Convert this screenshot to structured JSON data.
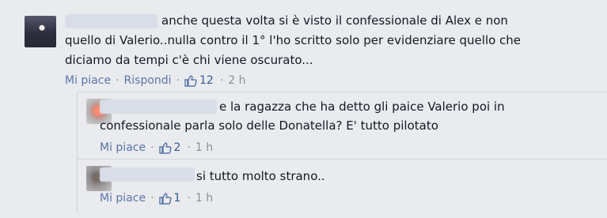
{
  "comments": [
    {
      "avatar_icon": "user-avatar-icon",
      "text_lines": [
        "anche questa volta si è visto il confessionale di Alex e non",
        "quello di Valerio..nulla contro il 1° l'ho scritto solo per evidenziare quello che",
        "diciamo da tempi c'è chi viene oscurato..."
      ],
      "actions": {
        "like_label": "Mi piace",
        "reply_label": "Rispondi",
        "likes": "12",
        "time": "2 h"
      }
    },
    {
      "avatar_icon": "user-avatar-icon",
      "text_lines": [
        "e la ragazza che ha detto gli paice Valerio poi in",
        "confessionale parla solo delle Donatella? E' tutto pilotato"
      ],
      "actions": {
        "like_label": "Mi piace",
        "likes": "2",
        "time": "1 h"
      }
    },
    {
      "avatar_icon": "user-avatar-icon",
      "text_lines": [
        "si tutto molto strano.."
      ],
      "actions": {
        "like_label": "Mi piace",
        "likes": "1",
        "time": "1 h"
      }
    }
  ],
  "ui": {
    "separator": "·",
    "like_icon": "thumbs-up-icon",
    "link_color": "#5b75a8",
    "meta_color": "#8b9097"
  }
}
